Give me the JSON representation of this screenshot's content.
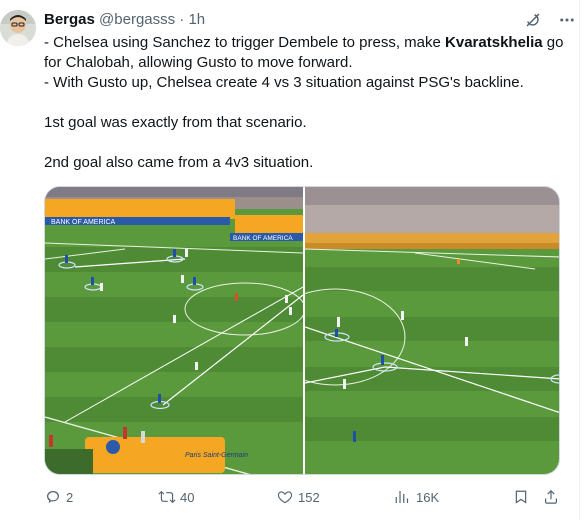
{
  "tweet": {
    "author_name": "Bergas",
    "author_handle": "@bergasss",
    "separator": "·",
    "time": "1h",
    "lines": [
      "- Chelsea using Sanchez to trigger Dembele to press, make ",
      "Kvaratskhelia",
      " go for Chalobah, allowing Gusto to move forward.",
      "- With Gusto up, Chelsea create 4 vs 3 situation against PSG's backline.",
      "1st goal was exactly from that scenario.",
      "2nd goal also came from a 4v3 situation."
    ],
    "stats": {
      "replies": "2",
      "retweets": "40",
      "likes": "152",
      "views": "16K"
    },
    "ad_text": {
      "boa_left": "BANK OF AMERICA",
      "boa_right": "BANK OF AMERICA",
      "psg_banner": "Paris Saint-Germain"
    }
  },
  "icons": [
    "grok-icon",
    "more-icon",
    "reply-icon",
    "retweet-icon",
    "like-icon",
    "views-icon",
    "bookmark-icon",
    "share-icon"
  ],
  "colors": {
    "text": "#0f1419",
    "secondary": "#536471",
    "pitch": "#4e8b34",
    "chelsea_kit": "#1f4fa8",
    "psg_kit": "#f2f2f2"
  }
}
